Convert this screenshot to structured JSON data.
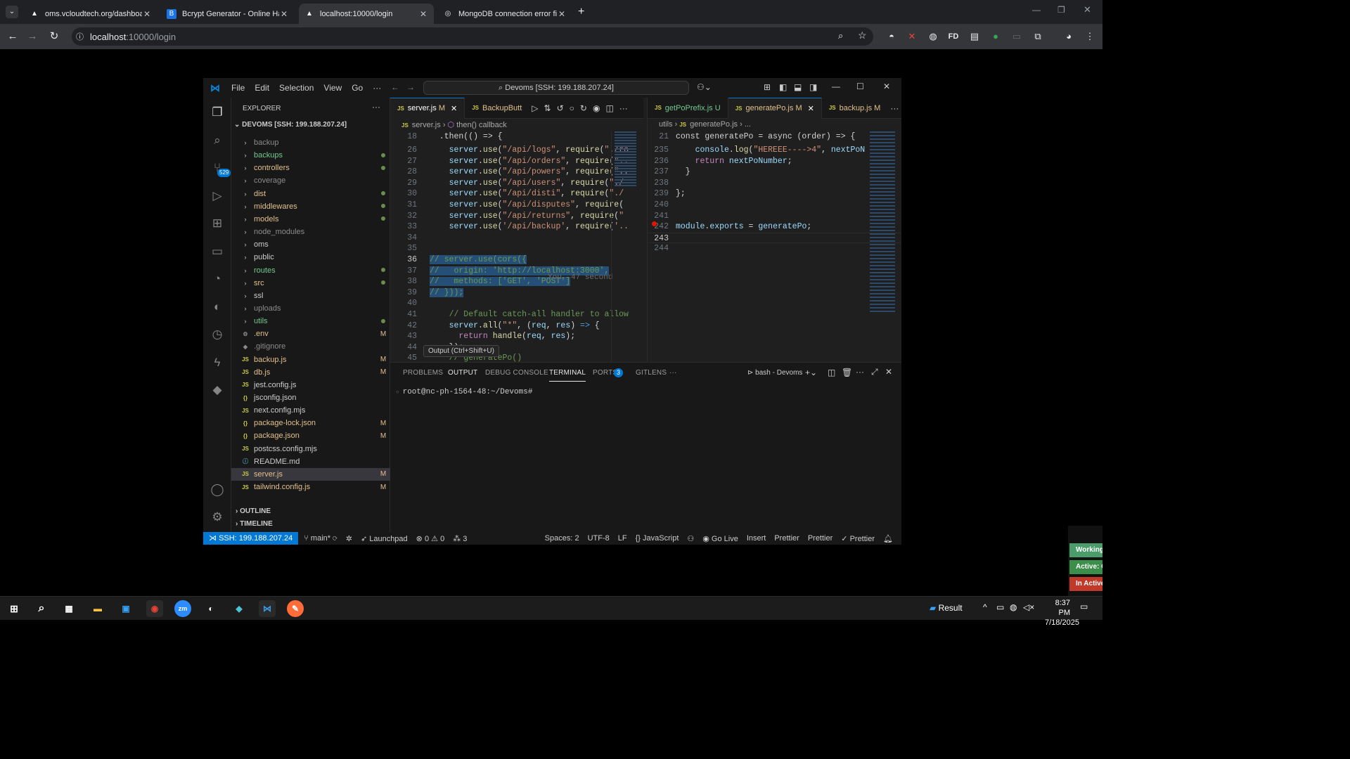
{
  "browser": {
    "tabs": [
      {
        "title": "oms.vcloudtech.org/dashboard",
        "favicon": "A"
      },
      {
        "title": "Bcrypt Generator - Online Hash",
        "favicon": "B"
      },
      {
        "title": "localhost:10000/login",
        "favicon": "A",
        "active": true
      },
      {
        "title": "MongoDB connection error fix",
        "favicon": "◎"
      }
    ],
    "url_host": "localhost",
    "url_path": ":10000/login"
  },
  "vscode": {
    "menu": [
      "File",
      "Edit",
      "Selection",
      "View",
      "Go",
      "···"
    ],
    "command_center": "Devoms [SSH: 199.188.207.24]",
    "activity_badge": "529",
    "explorer": {
      "title": "EXPLORER",
      "root": "DEVOMS [SSH: 199.188.207.24]",
      "items": [
        {
          "name": "backup",
          "type": "folder",
          "color": "dim",
          "status": ""
        },
        {
          "name": "backups",
          "type": "folder",
          "color": "green",
          "status": "dot"
        },
        {
          "name": "controllers",
          "type": "folder",
          "color": "yellow",
          "status": "dot"
        },
        {
          "name": "coverage",
          "type": "folder",
          "color": "dim",
          "status": ""
        },
        {
          "name": "dist",
          "type": "folder",
          "color": "yellow",
          "status": "dot"
        },
        {
          "name": "middlewares",
          "type": "folder",
          "color": "yellow",
          "status": "dot"
        },
        {
          "name": "models",
          "type": "folder",
          "color": "yellow",
          "status": "dot"
        },
        {
          "name": "node_modules",
          "type": "folder",
          "color": "dim",
          "status": ""
        },
        {
          "name": "oms",
          "type": "folder",
          "color": "plain",
          "status": ""
        },
        {
          "name": "public",
          "type": "folder",
          "color": "plain",
          "status": ""
        },
        {
          "name": "routes",
          "type": "folder",
          "color": "green",
          "status": "dot"
        },
        {
          "name": "src",
          "type": "folder",
          "color": "yellow",
          "status": "dot"
        },
        {
          "name": "ssl",
          "type": "folder",
          "color": "plain",
          "status": ""
        },
        {
          "name": "uploads",
          "type": "folder",
          "color": "dim",
          "status": ""
        },
        {
          "name": "utils",
          "type": "folder",
          "color": "green",
          "status": "dot"
        },
        {
          "name": ".env",
          "type": "gear",
          "color": "yellow",
          "status": "M"
        },
        {
          "name": ".gitignore",
          "type": "git",
          "color": "dim",
          "status": ""
        },
        {
          "name": "backup.js",
          "type": "js",
          "color": "yellow",
          "status": "M"
        },
        {
          "name": "db.js",
          "type": "js",
          "color": "yellow",
          "status": "M"
        },
        {
          "name": "jest.config.js",
          "type": "js",
          "color": "plain",
          "status": ""
        },
        {
          "name": "jsconfig.json",
          "type": "json",
          "color": "plain",
          "status": ""
        },
        {
          "name": "next.config.mjs",
          "type": "js",
          "color": "plain",
          "status": ""
        },
        {
          "name": "package-lock.json",
          "type": "json",
          "color": "yellow",
          "status": "M"
        },
        {
          "name": "package.json",
          "type": "json",
          "color": "yellow",
          "status": "M"
        },
        {
          "name": "postcss.config.mjs",
          "type": "js",
          "color": "plain",
          "status": ""
        },
        {
          "name": "README.md",
          "type": "info",
          "color": "plain",
          "status": ""
        },
        {
          "name": "server.js",
          "type": "js",
          "color": "yellow",
          "status": "M",
          "selected": true
        },
        {
          "name": "tailwind.config.js",
          "type": "js",
          "color": "yellow",
          "status": "M"
        }
      ],
      "outline": "OUTLINE",
      "timeline": "TIMELINE"
    },
    "left_editor": {
      "tabs": [
        {
          "label": "server.js",
          "status": "M",
          "active": true
        },
        {
          "label": "BackupButt",
          "status": ""
        }
      ],
      "breadcrumb_file": "server.js",
      "breadcrumb_symbol": "then() callback",
      "sticky_line": {
        "num": "18",
        "code": "  .then(() => {"
      },
      "blame": "You, 47 second",
      "tooltip": "Output (Ctrl+Shift+U)"
    },
    "right_editor": {
      "tabs": [
        {
          "label": "getPoPrefix.js",
          "status": "U"
        },
        {
          "label": "generatePo.js",
          "status": "M",
          "active": true
        },
        {
          "label": "backup.js",
          "status": "M"
        }
      ],
      "breadcrumb_folder": "utils",
      "breadcrumb_file": "generatePo.js",
      "breadcrumb_tail": "...",
      "sticky_line": {
        "num": "21",
        "code": "const generatePo = async (order) => {"
      }
    },
    "panel": {
      "tabs": [
        "PROBLEMS",
        "OUTPUT",
        "DEBUG CONSOLE",
        "TERMINAL",
        "PORTS",
        "GITLENS"
      ],
      "ports_badge": "3",
      "shell": "bash - Devoms",
      "prompt": "root@nc-ph-1564-48:~/Devoms#"
    },
    "status": {
      "remote": "SSH: 199.188.207.24",
      "branch": "main*",
      "launchpad": "Launchpad",
      "errors": "0",
      "warnings": "0",
      "ports": "3",
      "spaces": "Spaces: 2",
      "encoding": "UTF-8",
      "eol": "LF",
      "language": "JavaScript",
      "golive": "Go Live",
      "insert": "Insert",
      "prettier1": "Prettier",
      "prettier2": "Prettier",
      "prettier3": "Prettier"
    }
  },
  "side_chips": [
    {
      "label": "Working",
      "color": "#4a9d6a"
    },
    {
      "label": "Active: C",
      "color": "#3c8f4a"
    },
    {
      "label": "In Active",
      "color": "#c0392b"
    }
  ],
  "taskbar": {
    "result_label": "Result",
    "time": "8:37 PM",
    "date": "7/18/2025"
  },
  "colors": {
    "accent": "#0078d4",
    "selection": "#264f78"
  }
}
